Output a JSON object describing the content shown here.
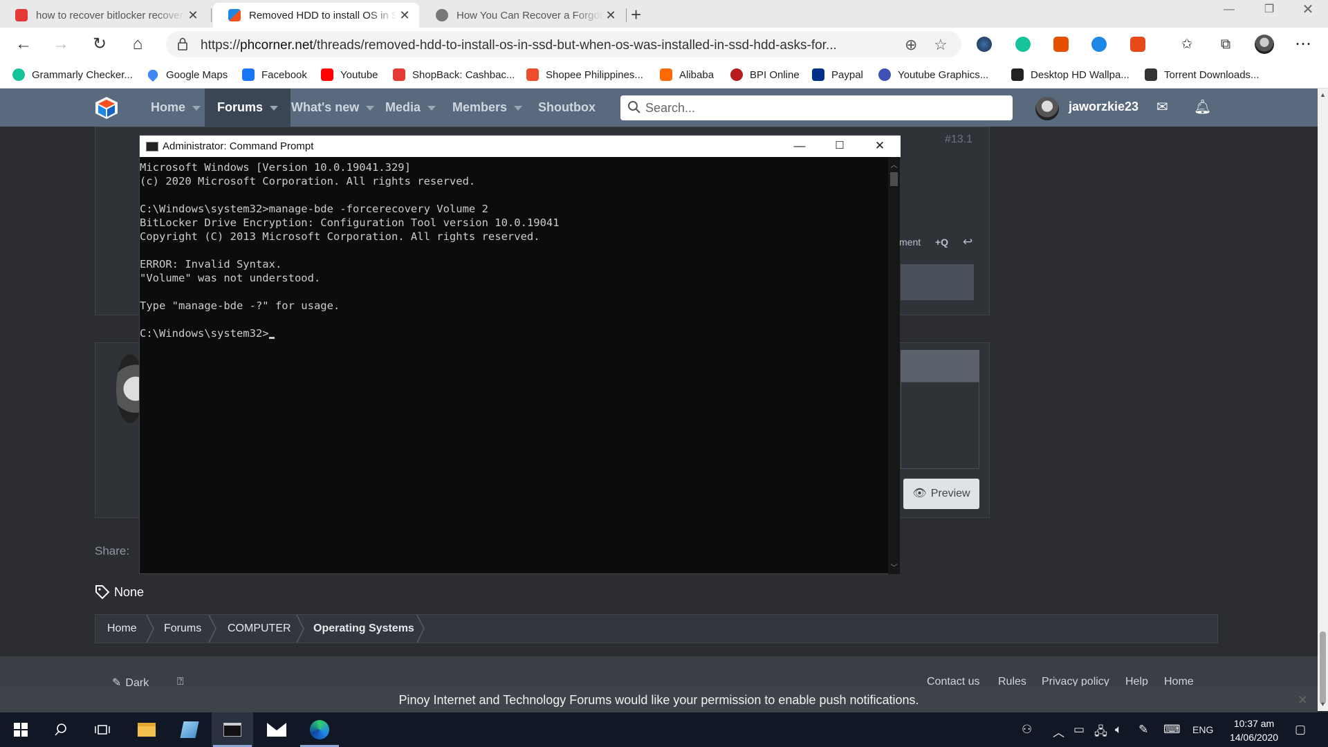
{
  "browser": {
    "tabs": [
      {
        "title": "how to recover bitlocker recover",
        "favicon_color": "#e53935"
      },
      {
        "title": "Removed HDD to install OS in SSD",
        "favicon_color": "#1e88e5"
      },
      {
        "title": "How You Can Recover a Forgotten",
        "favicon_color": "#777777"
      }
    ],
    "url_prefix": "https://",
    "url_host": "phcorner.net",
    "url_path": "/threads/removed-hdd-to-install-os-in-ssd-but-when-os-was-installed-in-ssd-hdd-asks-for...",
    "bookmarks": [
      {
        "label": "Grammarly Checker...",
        "color": "#15c39a"
      },
      {
        "label": "Google Maps",
        "color": "#4285f4"
      },
      {
        "label": "Facebook",
        "color": "#1877f2"
      },
      {
        "label": "Youtube",
        "color": "#ff0000"
      },
      {
        "label": "ShopBack: Cashbac...",
        "color": "#e53935"
      },
      {
        "label": "Shopee Philippines...",
        "color": "#ee4d2d"
      },
      {
        "label": "Alibaba",
        "color": "#ff6a00"
      },
      {
        "label": "BPI Online",
        "color": "#b71c1c"
      },
      {
        "label": "Paypal",
        "color": "#003087"
      },
      {
        "label": "Youtube Graphics...",
        "color": "#3f51b5"
      },
      {
        "label": "Desktop HD Wallpa...",
        "color": "#222222"
      },
      {
        "label": "Torrent Downloads...",
        "color": "#333333"
      }
    ]
  },
  "forum": {
    "nav": {
      "home": "Home",
      "forums": "Forums",
      "whats_new": "What's new",
      "media": "Media",
      "members": "Members",
      "shoutbox": "Shoutbox"
    },
    "search_placeholder": "Search...",
    "username": "jaworzkie23",
    "post_number": "#13.1",
    "post_actions": {
      "comment_partial": "ment",
      "quote": "+Q"
    },
    "preview_label": "Preview",
    "share_label": "Share:",
    "tags_value": "None",
    "breadcrumbs": [
      "Home",
      "Forums",
      "COMPUTER",
      "Operating Systems"
    ],
    "footer": {
      "dark": "Dark",
      "contact": "Contact us",
      "rules": "Rules",
      "privacy": "Privacy policy",
      "help": "Help",
      "home": "Home"
    },
    "push_notice": "Pinoy Internet and Technology Forums would like your permission to enable push notifications."
  },
  "cmd": {
    "title": "Administrator: Command Prompt",
    "lines": [
      "Microsoft Windows [Version 10.0.19041.329]",
      "(c) 2020 Microsoft Corporation. All rights reserved.",
      "",
      "C:\\Windows\\system32>manage-bde -forcerecovery Volume 2",
      "BitLocker Drive Encryption: Configuration Tool version 10.0.19041",
      "Copyright (C) 2013 Microsoft Corporation. All rights reserved.",
      "",
      "ERROR: Invalid Syntax.",
      "\"Volume\" was not understood.",
      "",
      "Type \"manage-bde -?\" for usage.",
      "",
      "C:\\Windows\\system32>"
    ]
  },
  "taskbar": {
    "language": "ENG",
    "time": "10:37 am",
    "date": "14/06/2020"
  }
}
